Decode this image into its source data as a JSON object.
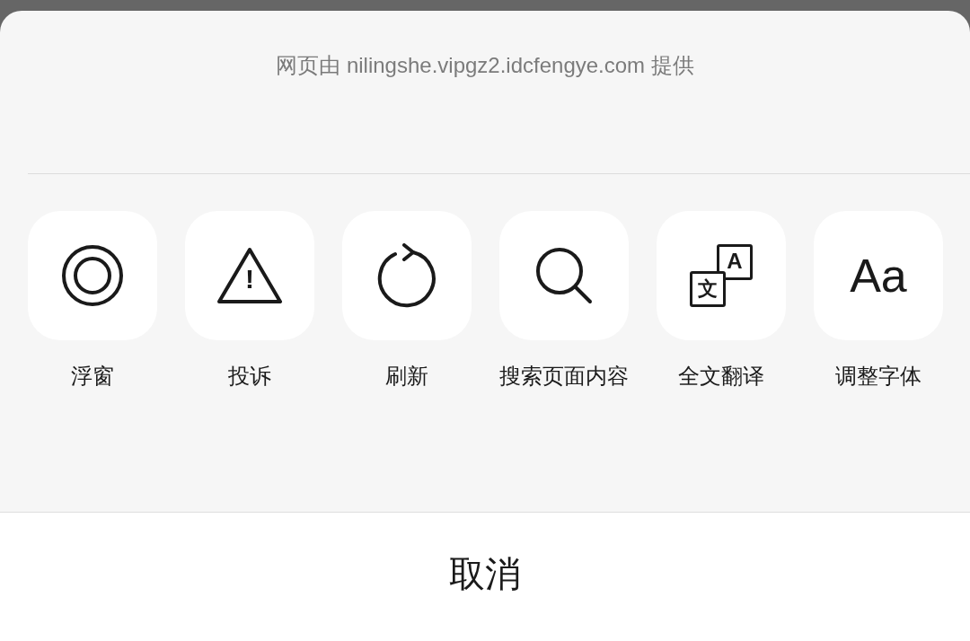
{
  "sheet": {
    "source_note": "网页由 nilingshe.vipgz2.idcfengye.com 提供"
  },
  "actions": [
    {
      "kind": "float",
      "label": "浮窗"
    },
    {
      "kind": "warning",
      "label": "投诉",
      "glyph": "!"
    },
    {
      "kind": "refresh",
      "label": "刷新"
    },
    {
      "kind": "search",
      "label": "搜索页面内容"
    },
    {
      "kind": "translate",
      "label": "全文翻译",
      "glyphs": [
        "A",
        "文"
      ]
    },
    {
      "kind": "font",
      "label": "调整字体",
      "glyph": "Aa"
    }
  ],
  "cancel_button": {
    "label": "取消"
  }
}
